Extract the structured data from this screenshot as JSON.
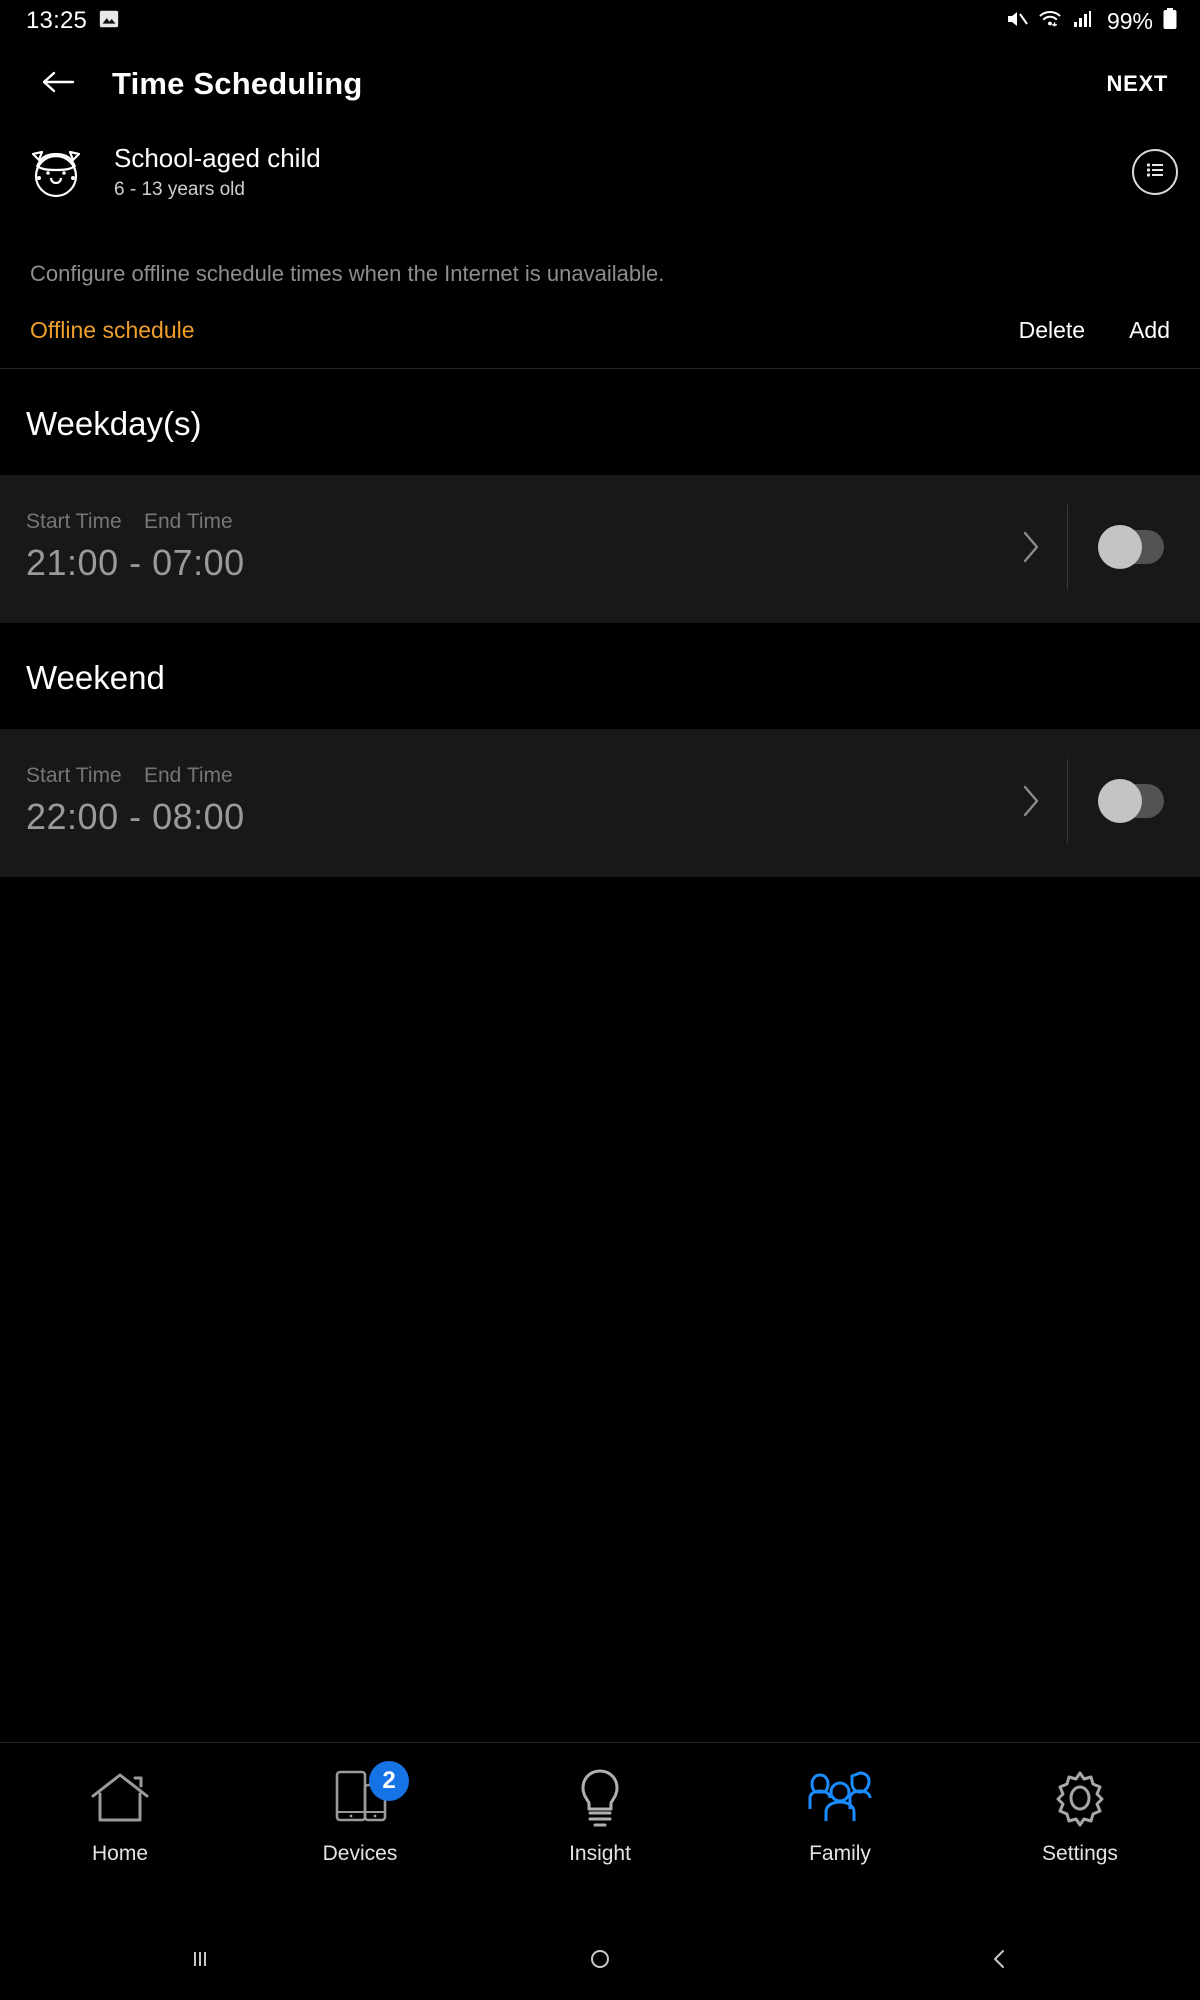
{
  "status_bar": {
    "clock": "13:25",
    "battery_percent": "99%",
    "icons": [
      "image-icon",
      "mute-icon",
      "wifi-icon",
      "signal-icon",
      "battery-icon"
    ]
  },
  "app_bar": {
    "back_icon": "back-arrow-icon",
    "title": "Time Scheduling",
    "next_label": "NEXT"
  },
  "profile": {
    "avatar_icon": "child-face-avatar",
    "name": "School-aged child",
    "age_range": "6 - 13 years old",
    "list_icon": "list-view-icon"
  },
  "description": "Configure offline schedule times when the Internet is unavailable.",
  "offline_schedule": {
    "label": "Offline schedule",
    "label_color": "#f0a02a",
    "delete_label": "Delete",
    "add_label": "Add"
  },
  "sections": [
    {
      "title": "Weekday(s)",
      "start_label": "Start Time",
      "end_label": "End Time",
      "time_range": "21:00 - 07:00",
      "toggle_state": "off",
      "chevron_icon": "chevron-right-icon"
    },
    {
      "title": "Weekend",
      "start_label": "Start Time",
      "end_label": "End Time",
      "time_range": "22:00 - 08:00",
      "toggle_state": "off",
      "chevron_icon": "chevron-right-icon"
    }
  ],
  "bottom_nav": {
    "active_color": "#1a8cff",
    "items": [
      {
        "label": "Home",
        "icon": "home-icon",
        "badge": "",
        "active": "false"
      },
      {
        "label": "Devices",
        "icon": "devices-icon",
        "badge": "2",
        "active": "false"
      },
      {
        "label": "Insight",
        "icon": "bulb-icon",
        "badge": "",
        "active": "false"
      },
      {
        "label": "Family",
        "icon": "family-icon",
        "badge": "",
        "active": "true"
      },
      {
        "label": "Settings",
        "icon": "gear-icon",
        "badge": "",
        "active": "false"
      }
    ]
  },
  "android_nav": {
    "recents_icon": "recents-icon",
    "home_icon": "home-circle-icon",
    "back_icon": "back-chevron-icon"
  }
}
